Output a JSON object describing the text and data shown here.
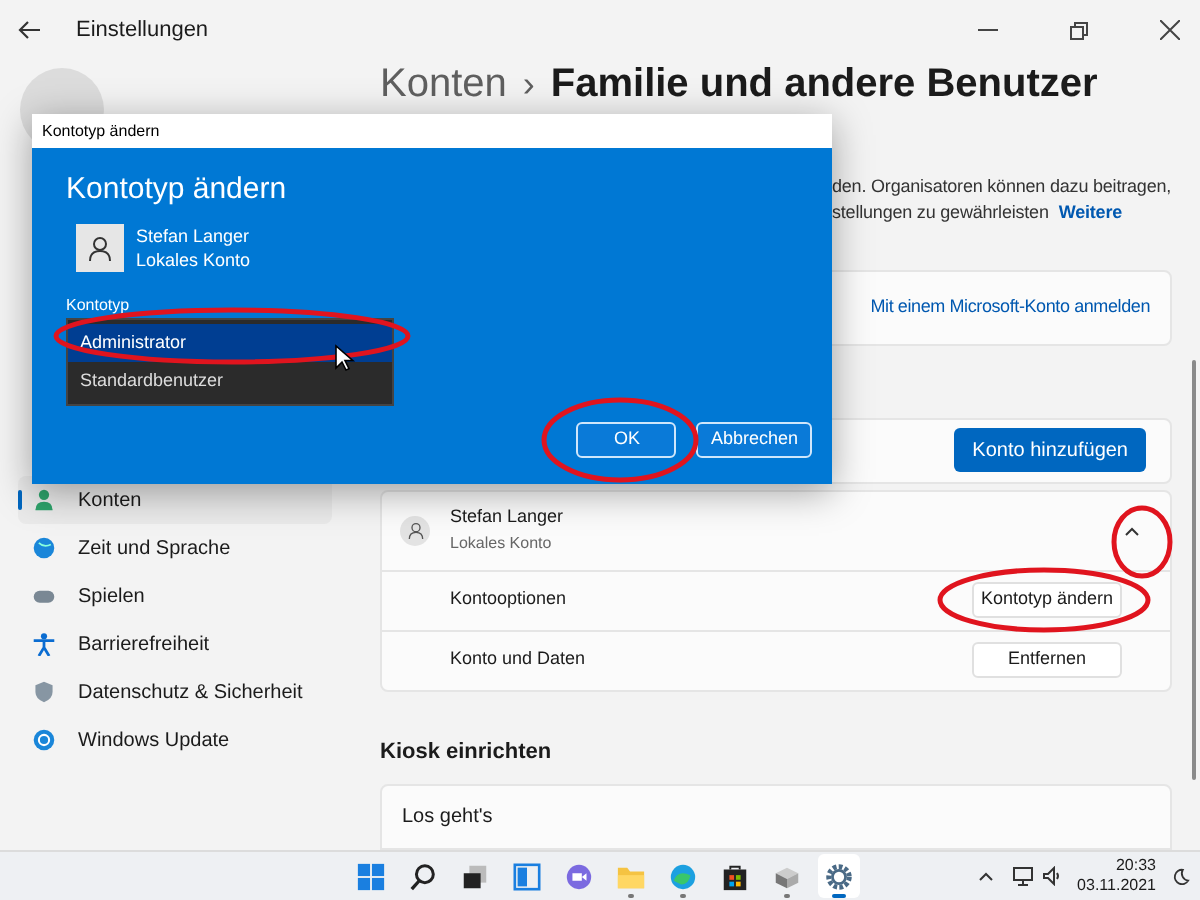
{
  "window": {
    "title": "Einstellungen"
  },
  "breadcrumb": {
    "parent": "Konten",
    "separator": "›",
    "current": "Familie und andere Benutzer"
  },
  "sidebar": {
    "items": [
      {
        "label": "Konten",
        "selected": true
      },
      {
        "label": "Zeit und Sprache",
        "selected": false
      },
      {
        "label": "Spielen",
        "selected": false
      },
      {
        "label": "Barrierefreiheit",
        "selected": false
      },
      {
        "label": "Datenschutz & Sicherheit",
        "selected": false
      },
      {
        "label": "Windows Update",
        "selected": false
      }
    ]
  },
  "intro": {
    "lines": [
      "den. Organisatoren können dazu beitragen,",
      "stellungen zu gewährleisten"
    ],
    "link": "Weitere"
  },
  "microsoft_card": {
    "link": "Mit einem Microsoft-Konto anmelden"
  },
  "add_card": {
    "button": "Konto hinzufügen"
  },
  "user_card": {
    "name": "Stefan Langer",
    "subtitle": "Lokales Konto",
    "expanded": true,
    "rows": [
      {
        "label": "Kontooptionen",
        "button": "Kontotyp ändern"
      },
      {
        "label": "Konto und Daten",
        "button": "Entfernen"
      }
    ]
  },
  "kiosk": {
    "heading": "Kiosk einrichten",
    "card": "Los geht's"
  },
  "dialog": {
    "title": "Kontotyp ändern",
    "heading": "Kontotyp ändern",
    "user_name": "Stefan Langer",
    "user_type": "Lokales Konto",
    "field_label": "Kontotyp",
    "options": [
      {
        "label": "Administrator",
        "selected": true
      },
      {
        "label": "Standardbenutzer",
        "selected": false
      }
    ],
    "buttons": [
      "OK",
      "Abbrechen"
    ]
  },
  "taskbar": {
    "apps": [
      {
        "running": false,
        "active": false
      },
      {
        "running": false,
        "active": false
      },
      {
        "running": false,
        "active": false
      },
      {
        "running": false,
        "active": false
      },
      {
        "running": false,
        "active": false
      },
      {
        "running": true,
        "active": false
      },
      {
        "running": true,
        "active": false
      },
      {
        "running": false,
        "active": false
      },
      {
        "running": true,
        "active": false
      },
      {
        "running": true,
        "active": true
      }
    ],
    "time": "20:33",
    "date": "03.11.2021"
  }
}
